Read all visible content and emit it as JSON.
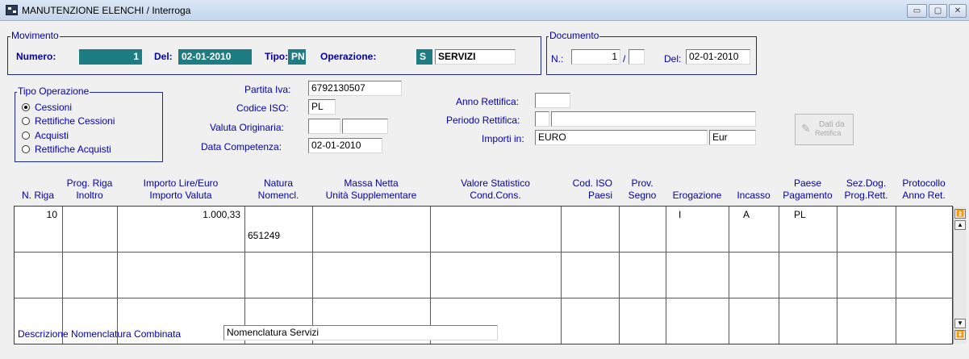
{
  "window": {
    "title": "MANUTENZIONE ELENCHI / Interroga",
    "minimize_label": "▭",
    "maximize_label": "▢",
    "close_label": "✕"
  },
  "movimento": {
    "group_label": "Movimento",
    "numero_label": "Numero:",
    "numero_value": "1",
    "del_label": "Del:",
    "del_value": "02-01-2010",
    "tipo_label": "Tipo:",
    "tipo_value": "PN",
    "operazione_label": "Operazione:",
    "operazione_code": "S",
    "operazione_desc": "SERVIZI"
  },
  "documento": {
    "group_label": "Documento",
    "n_label": "N.:",
    "n_value": "1",
    "slash": "/",
    "n_suffix": "",
    "del_label": "Del:",
    "del_value": "02-01-2010"
  },
  "tipo_operazione": {
    "group_label": "Tipo Operazione",
    "options": [
      "Cessioni",
      "Rettifiche Cessioni",
      "Acquisti",
      "Rettifiche Acquisti"
    ],
    "selected": "Cessioni"
  },
  "fields": {
    "partita_iva_label": "Partita Iva:",
    "partita_iva_value": "6792130507",
    "codice_iso_label": "Codice ISO:",
    "codice_iso_value": "PL",
    "valuta_label": "Valuta Originaria:",
    "valuta_value1": "",
    "valuta_value2": "",
    "data_comp_label": "Data Competenza:",
    "data_comp_value": "02-01-2010",
    "anno_rettifica_label": "Anno Rettifica:",
    "anno_rettifica_value": "",
    "periodo_rettifica_label": "Periodo Rettifica:",
    "periodo_rettifica_value1": "",
    "periodo_rettifica_value2": "",
    "importi_label": "Importi in:",
    "importi_value": "EURO",
    "importi_code": "Eur"
  },
  "dati_rettifica": {
    "line1": "Dati da",
    "line2": "Rettifica"
  },
  "table": {
    "headers": {
      "n_riga": "N. Riga",
      "prog_riga_1": "Prog. Riga",
      "prog_riga_2": "Inoltro",
      "importo_1": "Importo Lire/Euro",
      "importo_2": "Importo Valuta",
      "natura_1": "Natura",
      "natura_2": "Nomencl.",
      "massa_1": "Massa Netta",
      "massa_2": "Unità Supplementare",
      "valore_1": "Valore Statistico",
      "valore_2": "Cond.Cons.",
      "cod_iso_1": "Cod. ISO",
      "cod_iso_2": "Paesi",
      "prov_1": "Prov.",
      "prov_2": "Segno",
      "erogazione": "Erogazione",
      "incasso": "Incasso",
      "paese_1": "Paese",
      "paese_2": "Pagamento",
      "sezdog_1": "Sez.Dog.",
      "sezdog_2": "Prog.Rett.",
      "protocollo_1": "Protocollo",
      "protocollo_2": "Anno Ret."
    },
    "row1": {
      "n_riga": "10",
      "importo": "1.000,33",
      "natura": "651249",
      "erogazione": "I",
      "incasso": "A",
      "paese_pagamento": "PL"
    }
  },
  "footer": {
    "descr_label": "Descrizione Nomenclatura Combinata",
    "descr_value": "Nomenclatura Servizi"
  },
  "colors": {
    "label_blue": "#0000b0",
    "group_border": "#1c2a8c",
    "teal_field": "#1e7d82",
    "background": "#f0f0f0"
  }
}
